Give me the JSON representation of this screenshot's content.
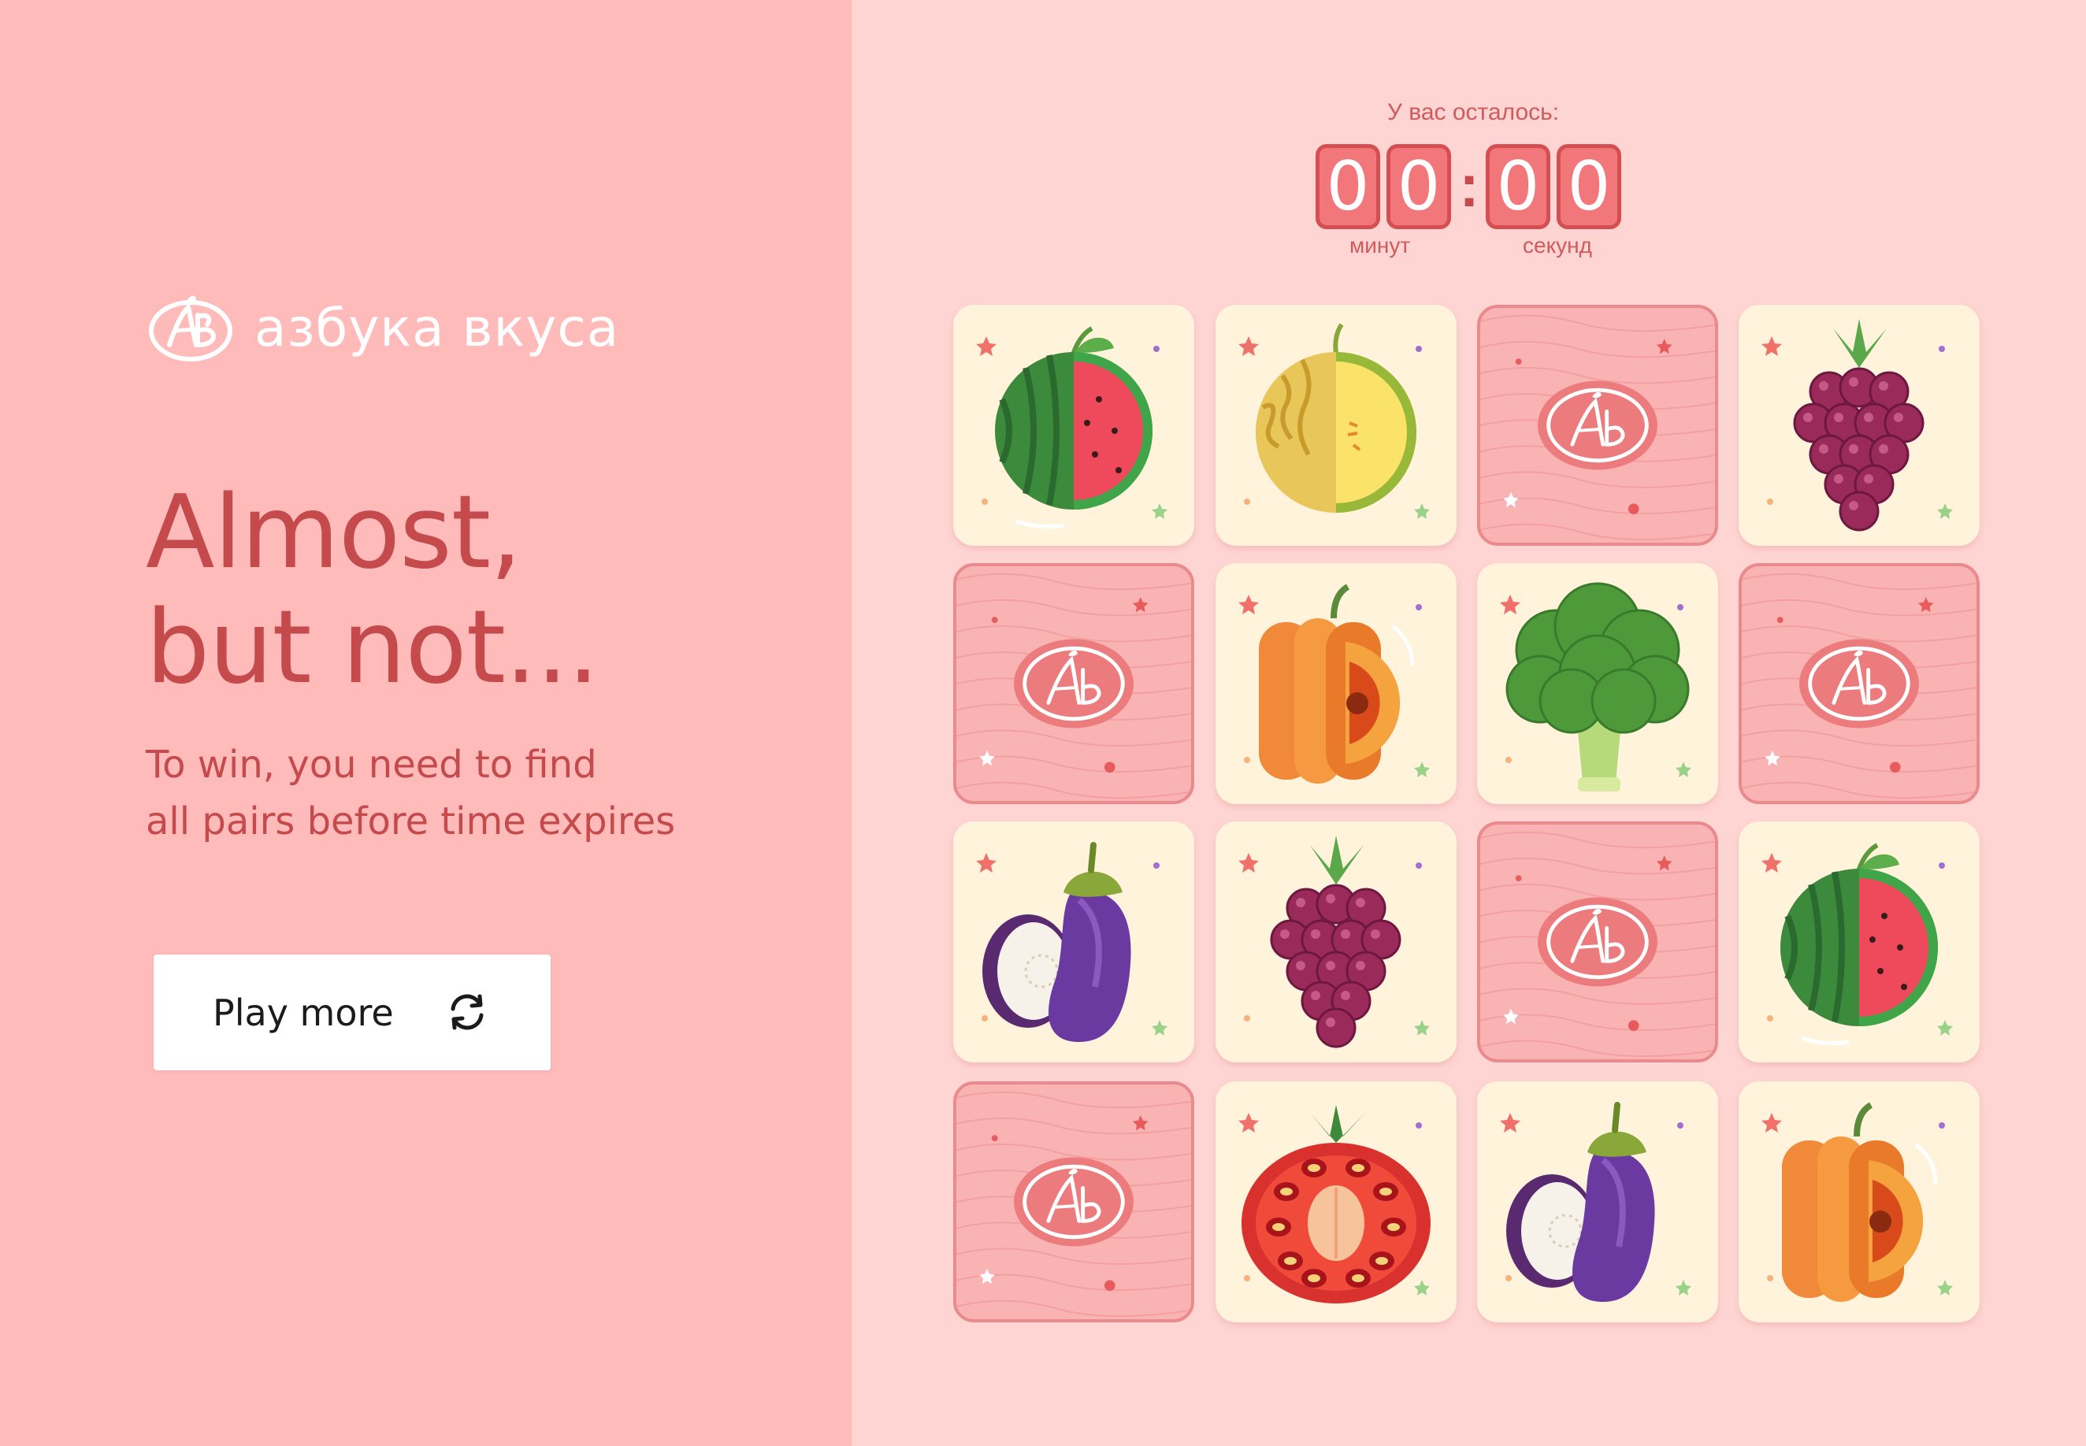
{
  "brand": {
    "name": "азбука вкуса",
    "logo_icon": "ab-monogram-icon"
  },
  "result": {
    "headline_lines": [
      "Almost,",
      "but not..."
    ],
    "subtext_lines": [
      "To win, you need to find",
      "all pairs before time expires"
    ]
  },
  "actions": {
    "play_more_label": "Play more",
    "play_more_icon": "refresh-icon"
  },
  "timer": {
    "title": "У вас осталось:",
    "minutes": [
      "0",
      "0"
    ],
    "seconds": [
      "0",
      "0"
    ],
    "separator": ":",
    "minutes_label": "минут",
    "seconds_label": "секунд"
  },
  "board": {
    "rows": 4,
    "cols": 4,
    "cards": [
      {
        "state": "open",
        "fruit": "watermelon"
      },
      {
        "state": "open",
        "fruit": "melon"
      },
      {
        "state": "hidden",
        "fruit": "card-back"
      },
      {
        "state": "open",
        "fruit": "raspberry"
      },
      {
        "state": "hidden",
        "fruit": "card-back"
      },
      {
        "state": "open",
        "fruit": "pumpkin"
      },
      {
        "state": "open",
        "fruit": "broccoli"
      },
      {
        "state": "hidden",
        "fruit": "card-back"
      },
      {
        "state": "open",
        "fruit": "eggplant"
      },
      {
        "state": "open",
        "fruit": "raspberry"
      },
      {
        "state": "hidden",
        "fruit": "card-back"
      },
      {
        "state": "open",
        "fruit": "watermelon"
      },
      {
        "state": "hidden",
        "fruit": "card-back"
      },
      {
        "state": "open",
        "fruit": "tomato"
      },
      {
        "state": "open",
        "fruit": "eggplant"
      },
      {
        "state": "open",
        "fruit": "pumpkin"
      }
    ]
  },
  "colors": {
    "left_panel": "#ffbbba",
    "right_panel": "#ffd5d3",
    "accent_text": "#c44a4c",
    "timer_digit": "#f2777a",
    "card_face": "#fff3dc",
    "card_back": "#f9b3b3"
  }
}
